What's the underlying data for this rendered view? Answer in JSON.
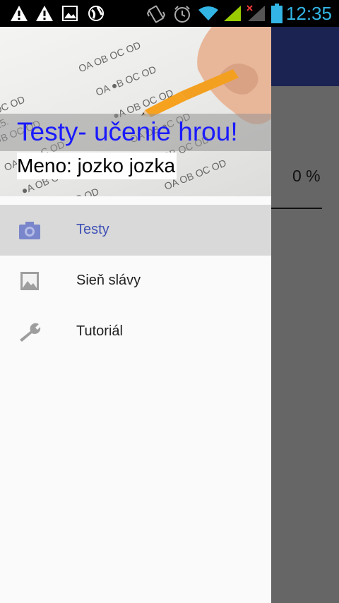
{
  "status_bar": {
    "time": "12:35",
    "icons": [
      "warning-icon",
      "warning-icon",
      "image-icon",
      "globe-icon",
      "vibrate-icon",
      "alarm-icon",
      "wifi-icon",
      "signal-icon",
      "signal-no-service-icon",
      "battery-icon"
    ]
  },
  "app": {
    "progress_text": "0 %"
  },
  "drawer": {
    "header": {
      "title": "Testy- učenie hrou!",
      "user_line": "Meno: jozko jozka"
    },
    "items": [
      {
        "label": "Testy",
        "icon": "camera-icon",
        "active": true
      },
      {
        "label": "Sieň slávy",
        "icon": "image-icon",
        "active": false
      },
      {
        "label": "Tutoriál",
        "icon": "wrench-icon",
        "active": false
      }
    ]
  },
  "colors": {
    "toolbar": "#1a2352",
    "accent": "#3f51b5",
    "title_blue": "#1a1aff",
    "status_time": "#33b5e5",
    "scrim": "#666666"
  }
}
